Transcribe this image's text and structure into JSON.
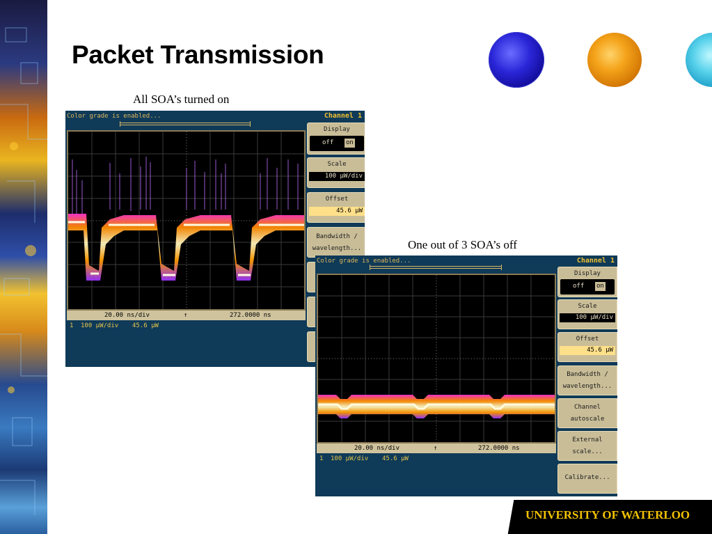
{
  "slide": {
    "title": "Packet Transmission",
    "caption_1": "All SOA’s turned on",
    "caption_2": "One out of 3 SOA’s off",
    "footer": "UNIVERSITY OF WATERLOO"
  },
  "scope_1": {
    "status": "Color grade is enabled...",
    "channel_title": "Channel 1",
    "display_label": "Display",
    "display_off": "off",
    "display_on": "on",
    "scale_label": "Scale",
    "scale_value": "100 µW/div",
    "offset_label": "Offset",
    "offset_value": "45.6 µW",
    "bandwidth_label_1": "Bandwidth /",
    "bandwidth_label_2": "wavelength...",
    "timebase": "20.00 ns/div",
    "trigger_glyph": "↑",
    "position": "272.0000 ns",
    "footer_channel": "1",
    "footer_scale": "100 µW/div",
    "footer_offset": "45.6 µW"
  },
  "scope_2": {
    "status": "Color grade is enabled...",
    "channel_title": "Channel 1",
    "display_label": "Display",
    "display_off": "off",
    "display_on": "on",
    "scale_label": "Scale",
    "scale_value": "100 µW/div",
    "offset_label": "Offset",
    "offset_value": "45.6 µW",
    "bandwidth_label_1": "Bandwidth /",
    "bandwidth_label_2": "wavelength...",
    "autoscale_label_1": "Channel",
    "autoscale_label_2": "autoscale",
    "external_label_1": "External",
    "external_label_2": "scale...",
    "calibrate_label": "Calibrate...",
    "timebase": "20.00 ns/div",
    "trigger_glyph": "↑",
    "position": "272.0000 ns",
    "footer_channel": "1",
    "footer_scale": "100 µW/div",
    "footer_offset": "45.6 µW"
  },
  "colors": {
    "scope_bg": "#0f3a58",
    "panel_button": "#c9bd98",
    "footer_text": "#f2c100",
    "channel_title": "#f0c030"
  }
}
